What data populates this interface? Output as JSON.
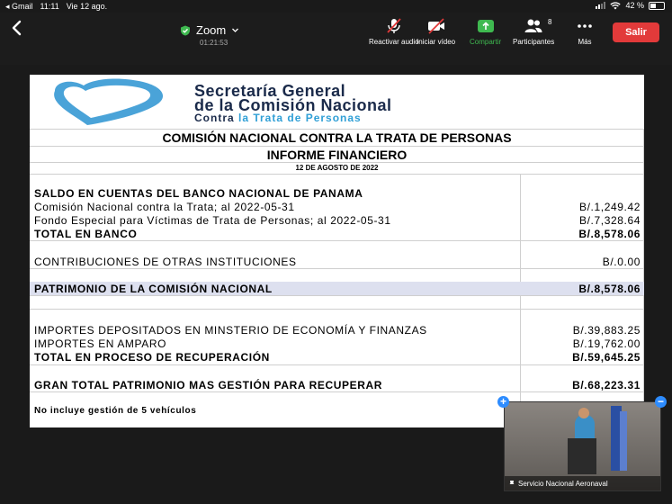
{
  "status_bar": {
    "back_app": "◂ Gmail",
    "time": "11:11",
    "date": "Vie 12 ago.",
    "battery": "42 %",
    "battery_level": 0.42
  },
  "toolbar": {
    "meeting_title": "Zoom",
    "elapsed": "01:21:53",
    "mute_label": "Reactivar audio",
    "video_label": "Iniciar vídeo",
    "share_label": "Compartir",
    "participants_label": "Participantes",
    "participants_count": "8",
    "more_label": "Más",
    "leave_label": "Salir",
    "share_color": "#3fb950",
    "leave_color": "#e23a3a"
  },
  "document": {
    "logo": {
      "line1": "Secretaría General",
      "line2": "de la Comisión Nacional",
      "line3a": "Contra ",
      "line3b": "la Trata de Personas"
    },
    "heading": "COMISIÓN NACIONAL CONTRA LA TRATA DE PERSONAS",
    "subheading": "INFORME FINANCIERO",
    "date": "12 DE AGOSTO DE 2022",
    "rows": [
      {
        "label": "SALDO EN CUENTAS DEL BANCO NACIONAL DE PANAMA",
        "value": ""
      },
      {
        "label": "Comisión Nacional contra la Trata; al 2022-05-31",
        "value": "B/.1,249.42"
      },
      {
        "label": "Fondo Especial para Víctimas de Trata de Personas; al 2022-05-31",
        "value": "B/.7,328.64"
      },
      {
        "label": "TOTAL EN BANCO",
        "value": "B/.8,578.06"
      },
      {
        "label": "CONTRIBUCIONES DE OTRAS INSTITUCIONES",
        "value": "B/.0.00"
      },
      {
        "label": "PATRIMONIO DE LA COMISIÓN NACIONAL",
        "value": "B/.8,578.06"
      },
      {
        "label": "IMPORTES DEPOSITADOS EN MINSTERIO DE ECONOMÍA Y FINANZAS",
        "value": "B/.39,883.25"
      },
      {
        "label": "IMPORTES EN AMPARO",
        "value": "B/.19,762.00"
      },
      {
        "label": "TOTAL EN PROCESO DE RECUPERACIÓN",
        "value": "B/.59,645.25"
      },
      {
        "label": "GRAN TOTAL PATRIMONIO MAS GESTIÓN PARA RECUPERAR",
        "value": "B/.68,223.31"
      },
      {
        "label": "No incluye gestión de 5 vehículos",
        "value": ""
      }
    ]
  },
  "self_video": {
    "name": "Servicio Nacional Aeronaval"
  }
}
